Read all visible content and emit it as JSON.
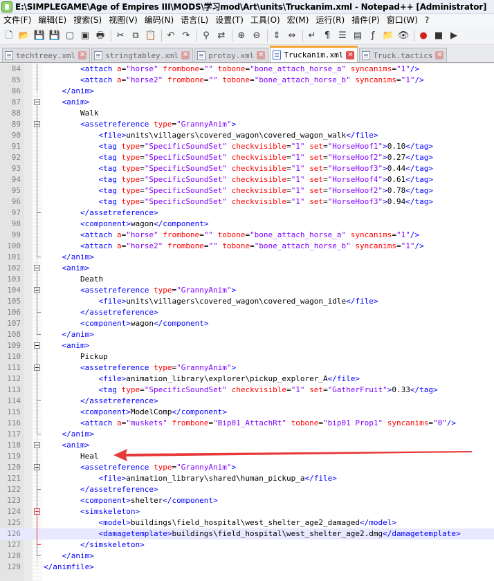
{
  "window": {
    "title": "E:\\SIMPLEGAME\\Age of Empires III\\MODS\\学习mod\\Art\\units\\Truckanim.xml - Notepad++ [Administrator]"
  },
  "menu": [
    "文件(F)",
    "编辑(E)",
    "搜索(S)",
    "视图(V)",
    "编码(N)",
    "语言(L)",
    "设置(T)",
    "工具(O)",
    "宏(M)",
    "运行(R)",
    "插件(P)",
    "窗口(W)",
    "?"
  ],
  "toolbar": {
    "icons": [
      "new-file-icon",
      "open-file-icon",
      "save-icon",
      "save-all-icon",
      "close-icon",
      "close-all-icon",
      "print-icon",
      "cut-icon",
      "copy-icon",
      "paste-icon",
      "undo-icon",
      "redo-icon",
      "find-icon",
      "replace-icon",
      "zoom-in-icon",
      "zoom-out-icon",
      "sync-vertical-icon",
      "sync-horizontal-icon",
      "word-wrap-icon",
      "show-all-chars-icon",
      "indent-guide-icon",
      "doc-map-icon",
      "function-list-icon",
      "folder-as-workspace-icon",
      "monitoring-icon",
      "record-macro-icon",
      "stop-macro-icon",
      "play-macro-icon"
    ]
  },
  "tabs": [
    {
      "label": "techtreey.xml",
      "active": false
    },
    {
      "label": "stringtabley.xml",
      "active": false
    },
    {
      "label": "protoy.xml",
      "active": false
    },
    {
      "label": "Truckanim.xml",
      "active": true
    },
    {
      "label": "Truck.tactics",
      "active": false
    }
  ],
  "editor": {
    "lines": [
      {
        "n": "84",
        "text": "        <attach a=\"horse\" frombone=\"\" tobone=\"bone_attach_horse_a\" syncanims=\"1\"/>"
      },
      {
        "n": "85",
        "text": "        <attach a=\"horse2\" frombone=\"\" tobone=\"bone_attach_horse_b\" syncanims=\"1\"/>"
      },
      {
        "n": "86",
        "text": "    </anim>"
      },
      {
        "n": "87",
        "text": "    <anim>"
      },
      {
        "n": "88",
        "text": "        Walk"
      },
      {
        "n": "89",
        "text": "        <assetreference type=\"GrannyAnim\">"
      },
      {
        "n": "90",
        "text": "            <file>units\\villagers\\covered_wagon\\covered_wagon_walk</file>"
      },
      {
        "n": "91",
        "text": "            <tag type=\"SpecificSoundSet\" checkvisible=\"1\" set=\"HorseHoof1\">0.10</tag>"
      },
      {
        "n": "92",
        "text": "            <tag type=\"SpecificSoundSet\" checkvisible=\"1\" set=\"HorseHoof2\">0.27</tag>"
      },
      {
        "n": "93",
        "text": "            <tag type=\"SpecificSoundSet\" checkvisible=\"1\" set=\"HorseHoof3\">0.44</tag>"
      },
      {
        "n": "94",
        "text": "            <tag type=\"SpecificSoundSet\" checkvisible=\"1\" set=\"HorseHoof4\">0.61</tag>"
      },
      {
        "n": "95",
        "text": "            <tag type=\"SpecificSoundSet\" checkvisible=\"1\" set=\"HorseHoof2\">0.78</tag>"
      },
      {
        "n": "96",
        "text": "            <tag type=\"SpecificSoundSet\" checkvisible=\"1\" set=\"HorseHoof3\">0.94</tag>"
      },
      {
        "n": "97",
        "text": "        </assetreference>"
      },
      {
        "n": "98",
        "text": "        <component>wagon</component>"
      },
      {
        "n": "99",
        "text": "        <attach a=\"horse\" frombone=\"\" tobone=\"bone_attach_horse_a\" syncanims=\"1\"/>"
      },
      {
        "n": "100",
        "text": "        <attach a=\"horse2\" frombone=\"\" tobone=\"bone_attach_horse_b\" syncanims=\"1\"/>"
      },
      {
        "n": "101",
        "text": "    </anim>"
      },
      {
        "n": "102",
        "text": "    <anim>"
      },
      {
        "n": "103",
        "text": "        Death"
      },
      {
        "n": "104",
        "text": "        <assetreference type=\"GrannyAnim\">"
      },
      {
        "n": "105",
        "text": "            <file>units\\villagers\\covered_wagon\\covered_wagon_idle</file>"
      },
      {
        "n": "106",
        "text": "        </assetreference>"
      },
      {
        "n": "107",
        "text": "        <component>wagon</component>"
      },
      {
        "n": "108",
        "text": "    </anim>"
      },
      {
        "n": "109",
        "text": "    <anim>"
      },
      {
        "n": "110",
        "text": "        Pickup"
      },
      {
        "n": "111",
        "text": "        <assetreference type=\"GrannyAnim\">"
      },
      {
        "n": "112",
        "text": "            <file>animation_library\\explorer\\pickup_explorer_A</file>"
      },
      {
        "n": "113",
        "text": "            <tag type=\"SpecificSoundSet\" checkvisible=\"1\" set=\"GatherFruit\">0.33</tag>"
      },
      {
        "n": "114",
        "text": "        </assetreference>"
      },
      {
        "n": "115",
        "text": "        <component>ModelComp</component>"
      },
      {
        "n": "116",
        "text": "        <attach a=\"muskets\" frombone=\"Bip01_AttachRt\" tobone=\"bip01 Prop1\" syncanims=\"0\"/>"
      },
      {
        "n": "117",
        "text": "    </anim>"
      },
      {
        "n": "118",
        "text": "    <anim>"
      },
      {
        "n": "119",
        "text": "        Heal"
      },
      {
        "n": "120",
        "text": "        <assetreference type=\"GrannyAnim\">"
      },
      {
        "n": "121",
        "text": "            <file>animation_library\\shared\\human_pickup_a</file>"
      },
      {
        "n": "122",
        "text": "        </assetreference>"
      },
      {
        "n": "123",
        "text": "        <component>shelter</component>"
      },
      {
        "n": "124",
        "text": "        <simskeleton>"
      },
      {
        "n": "125",
        "text": "            <model>buildings\\field_hospital\\west_shelter_age2_damaged</model>"
      },
      {
        "n": "126",
        "text": "            <damagetemplate>buildings\\field_hospital\\west_shelter_age2.dmg</damagetemplate>"
      },
      {
        "n": "127",
        "text": "        </simskeleton>"
      },
      {
        "n": "128",
        "text": "    </anim>"
      },
      {
        "n": "129",
        "text": "</animfile>"
      }
    ],
    "current_line": "126",
    "fold_boxes": [
      "87",
      "89",
      "102",
      "104",
      "109",
      "111",
      "118",
      "120",
      "124"
    ],
    "fold_boxes_red": [
      "124"
    ]
  },
  "annotation": {
    "color": "#e8393a",
    "points_to_line": "119"
  }
}
